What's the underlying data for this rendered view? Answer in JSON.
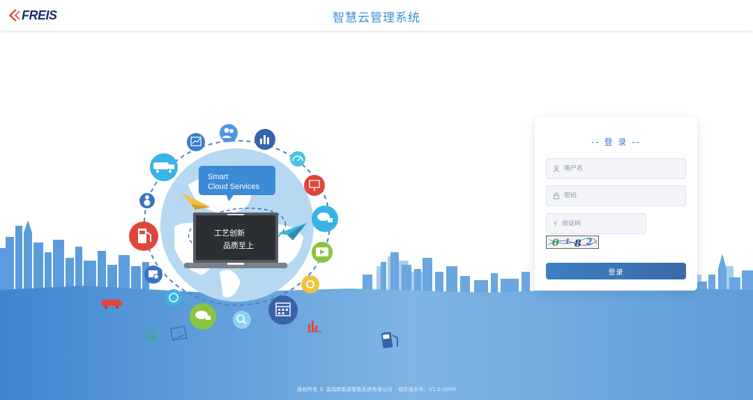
{
  "header": {
    "logo_text": "FREIS",
    "title": "智慧云管理系统"
  },
  "illustration": {
    "bubble_line1": "Smart",
    "bubble_line2": "Cloud Services",
    "screen_line1": "工艺创新",
    "screen_line2": "品质至上",
    "icons": [
      "chart-icon",
      "users-icon",
      "bar-chart-icon",
      "gauge-icon",
      "monitor-icon",
      "truck-icon",
      "mixer-truck-icon",
      "play-icon",
      "gas-station-icon",
      "settings-icon",
      "phone-icon",
      "calendar-icon",
      "search-icon",
      "gear-icon",
      "paper-plane-icon"
    ]
  },
  "login": {
    "title": "-- 登 录 --",
    "username_placeholder": "用户名",
    "password_placeholder": "密码",
    "captcha_placeholder": "验证码",
    "captcha_chars": [
      "0",
      "1",
      "8",
      "2"
    ],
    "submit_label": "登录"
  },
  "footer": {
    "copyright": "版权所有 © 富瑞新能源智能系统有限公司",
    "version": "软件版本号：V1.0.0000"
  },
  "colors": {
    "accent": "#3a8fd6",
    "logo_red": "#d9342b",
    "logo_navy": "#1b2f6b",
    "skyline_light": "#9fc8ea",
    "skyline_mid": "#5f9fdb",
    "skyline_dark": "#4a86c9"
  }
}
